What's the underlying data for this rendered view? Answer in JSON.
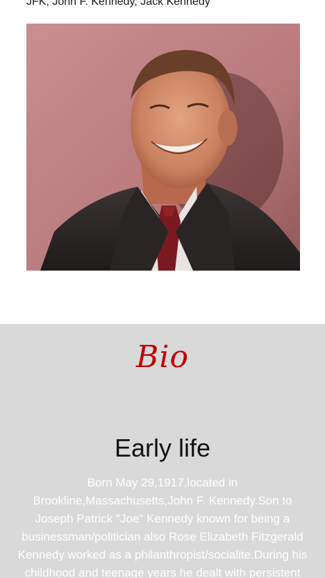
{
  "aliases": "JFK, John F. Kennedy, Jack Kennedy",
  "bio": {
    "heading": "Bio",
    "early_life_heading": "Early life",
    "early_life_text": "Born May 29,1917,located in Brookline,Massachusetts,John F. Kennedy.Son to Joseph Patrick \"Joe\" Kennedy known for being a businessman/politician also Rose Elizabeth Fitzgerald Kennedy worked as a philanthropist/socialite.During his childhood and teenage years he dealt with persistent"
  },
  "colors": {
    "bio_heading": "#c00000",
    "bio_background": "#d9d9d9",
    "text": "#111111"
  }
}
